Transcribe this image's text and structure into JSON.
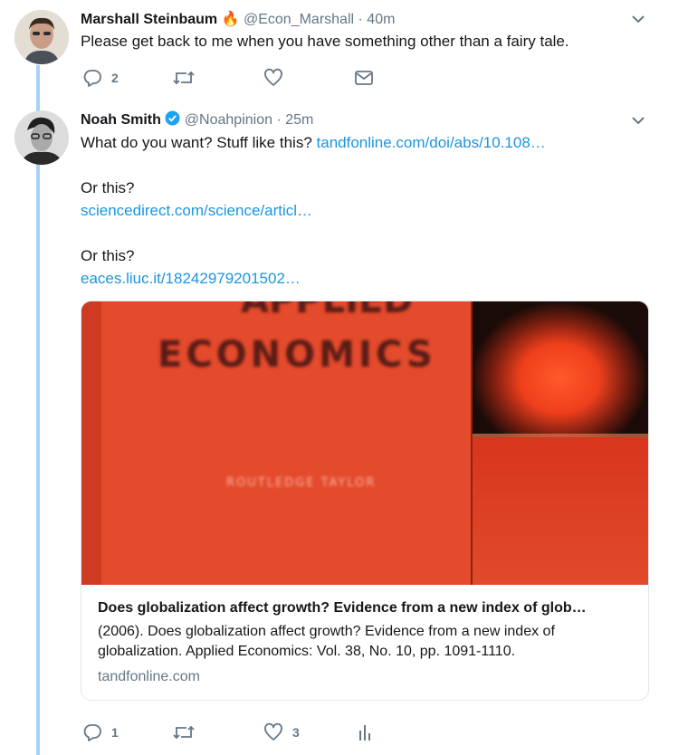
{
  "tweet1": {
    "name": "Marshall Steinbaum",
    "emoji": "🔥",
    "handle": "@Econ_Marshall",
    "time": "· 40m",
    "text": "Please get back to me when you have something other than a fairy tale.",
    "reply_count": "2",
    "retweet_count": "",
    "like_count": ""
  },
  "tweet2": {
    "name": "Noah Smith",
    "handle": "@Noahpinion",
    "time": "· 25m",
    "text_1": "What do you want? Stuff like this?",
    "link_1": "tandfonline.com/doi/abs/10.108…",
    "text_2": "Or this?",
    "link_2": "sciencedirect.com/science/articl…",
    "text_3": "Or this?",
    "link_3": "eaces.liuc.it/18242979201502…",
    "card": {
      "image_line_1": "APPLIED",
      "image_line_2": "ECONOMICS",
      "image_line_3": "ROUTLEDGE TAYLOR",
      "title": "Does globalization affect growth? Evidence from a new index of glob…",
      "description": "(2006). Does globalization affect growth? Evidence from a new index of globalization. Applied Economics: Vol. 38, No. 10, pp. 1091-1110.",
      "domain": "tandfonline.com"
    },
    "reply_count": "1",
    "retweet_count": "",
    "like_count": "3"
  },
  "colors": {
    "link": "#1b95e0",
    "thread_line": "#a8d2f5",
    "verified": "#1da1f2",
    "muted": "#657786",
    "card_red": "#e8452c"
  },
  "icons": [
    "reply-icon",
    "retweet-icon",
    "like-icon",
    "dm-icon",
    "analytics-icon",
    "caret-down-icon",
    "verified-badge-icon"
  ]
}
